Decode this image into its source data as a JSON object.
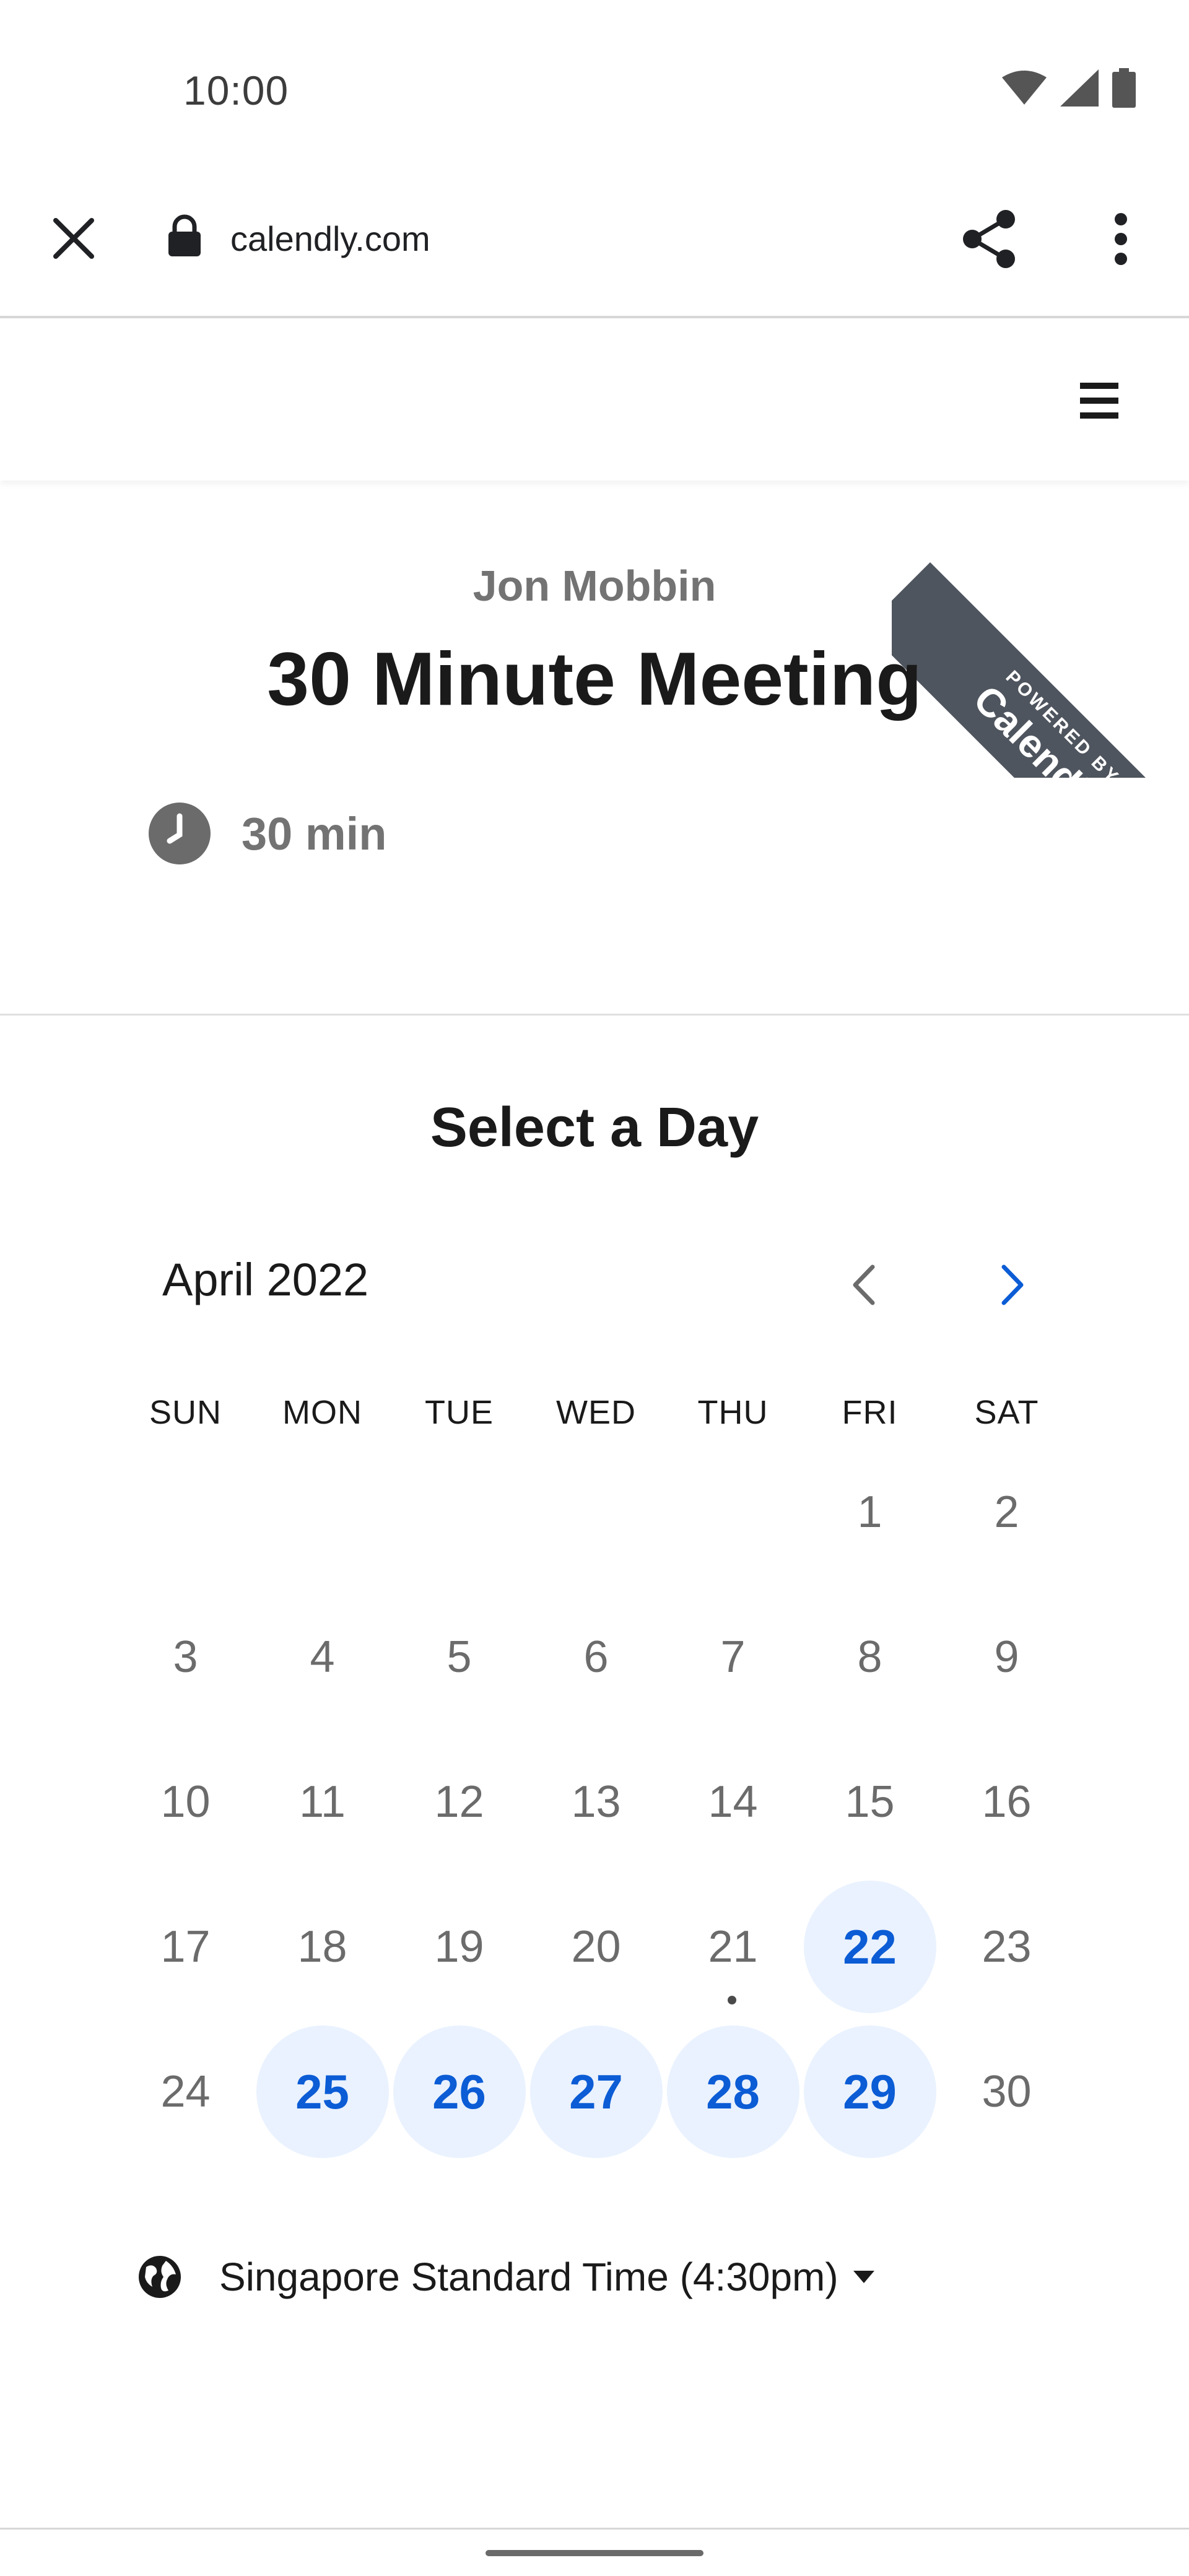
{
  "status_bar": {
    "time": "10:00",
    "icons": [
      "wifi-icon",
      "signal-icon",
      "battery-icon"
    ]
  },
  "browser": {
    "url": "calendly.com",
    "icons": [
      "close-icon",
      "lock-icon",
      "share-icon",
      "more-vert-icon"
    ]
  },
  "site_header": {
    "menu_icon": "hamburger-menu-icon"
  },
  "ribbon": {
    "small_text": "POWERED BY",
    "brand": "Calendly",
    "color": "#4f555e"
  },
  "event": {
    "host": "Jon Mobbin",
    "title": "30 Minute Meeting",
    "duration": "30 min"
  },
  "calendar": {
    "heading": "Select a Day",
    "month": "April 2022",
    "weekdays": [
      "SUN",
      "MON",
      "TUE",
      "WED",
      "THU",
      "FRI",
      "SAT"
    ],
    "days": [
      {
        "d": ""
      },
      {
        "d": ""
      },
      {
        "d": ""
      },
      {
        "d": ""
      },
      {
        "d": ""
      },
      {
        "d": "1"
      },
      {
        "d": "2"
      },
      {
        "d": "3"
      },
      {
        "d": "4"
      },
      {
        "d": "5"
      },
      {
        "d": "6"
      },
      {
        "d": "7"
      },
      {
        "d": "8"
      },
      {
        "d": "9"
      },
      {
        "d": "10"
      },
      {
        "d": "11"
      },
      {
        "d": "12"
      },
      {
        "d": "13"
      },
      {
        "d": "14"
      },
      {
        "d": "15"
      },
      {
        "d": "16"
      },
      {
        "d": "17"
      },
      {
        "d": "18"
      },
      {
        "d": "19"
      },
      {
        "d": "20"
      },
      {
        "d": "21",
        "today": true
      },
      {
        "d": "22",
        "available": true
      },
      {
        "d": "23"
      },
      {
        "d": "24"
      },
      {
        "d": "25",
        "available": true
      },
      {
        "d": "26",
        "available": true
      },
      {
        "d": "27",
        "available": true
      },
      {
        "d": "28",
        "available": true
      },
      {
        "d": "29",
        "available": true
      },
      {
        "d": "30"
      }
    ],
    "accent_color": "#0b5cd5",
    "available_bg": "#eaf2ff"
  },
  "timezone": {
    "label": "Singapore Standard Time (4:30pm)"
  }
}
